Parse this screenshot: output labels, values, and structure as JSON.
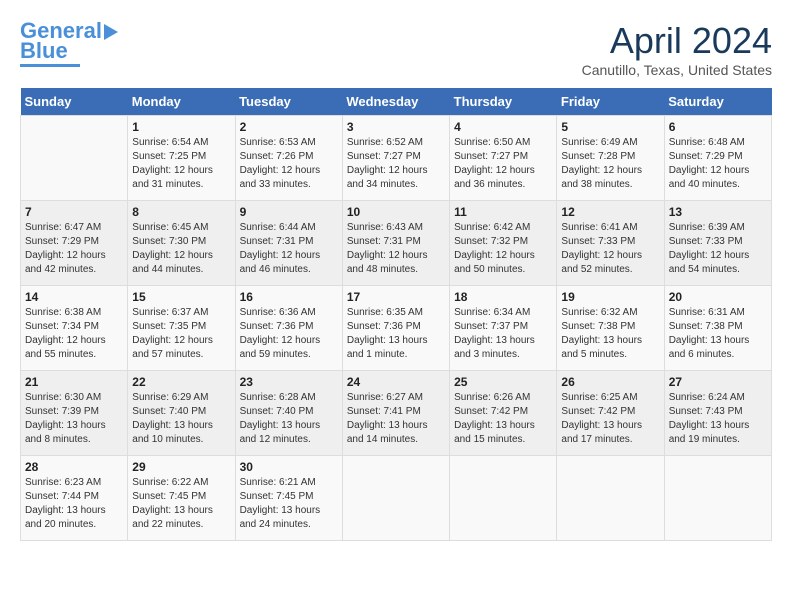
{
  "header": {
    "logo_line1": "General",
    "logo_line2": "Blue",
    "month_title": "April 2024",
    "location": "Canutillo, Texas, United States"
  },
  "calendar": {
    "days_of_week": [
      "Sunday",
      "Monday",
      "Tuesday",
      "Wednesday",
      "Thursday",
      "Friday",
      "Saturday"
    ],
    "weeks": [
      [
        {
          "day": "",
          "info": ""
        },
        {
          "day": "1",
          "info": "Sunrise: 6:54 AM\nSunset: 7:25 PM\nDaylight: 12 hours\nand 31 minutes."
        },
        {
          "day": "2",
          "info": "Sunrise: 6:53 AM\nSunset: 7:26 PM\nDaylight: 12 hours\nand 33 minutes."
        },
        {
          "day": "3",
          "info": "Sunrise: 6:52 AM\nSunset: 7:27 PM\nDaylight: 12 hours\nand 34 minutes."
        },
        {
          "day": "4",
          "info": "Sunrise: 6:50 AM\nSunset: 7:27 PM\nDaylight: 12 hours\nand 36 minutes."
        },
        {
          "day": "5",
          "info": "Sunrise: 6:49 AM\nSunset: 7:28 PM\nDaylight: 12 hours\nand 38 minutes."
        },
        {
          "day": "6",
          "info": "Sunrise: 6:48 AM\nSunset: 7:29 PM\nDaylight: 12 hours\nand 40 minutes."
        }
      ],
      [
        {
          "day": "7",
          "info": "Sunrise: 6:47 AM\nSunset: 7:29 PM\nDaylight: 12 hours\nand 42 minutes."
        },
        {
          "day": "8",
          "info": "Sunrise: 6:45 AM\nSunset: 7:30 PM\nDaylight: 12 hours\nand 44 minutes."
        },
        {
          "day": "9",
          "info": "Sunrise: 6:44 AM\nSunset: 7:31 PM\nDaylight: 12 hours\nand 46 minutes."
        },
        {
          "day": "10",
          "info": "Sunrise: 6:43 AM\nSunset: 7:31 PM\nDaylight: 12 hours\nand 48 minutes."
        },
        {
          "day": "11",
          "info": "Sunrise: 6:42 AM\nSunset: 7:32 PM\nDaylight: 12 hours\nand 50 minutes."
        },
        {
          "day": "12",
          "info": "Sunrise: 6:41 AM\nSunset: 7:33 PM\nDaylight: 12 hours\nand 52 minutes."
        },
        {
          "day": "13",
          "info": "Sunrise: 6:39 AM\nSunset: 7:33 PM\nDaylight: 12 hours\nand 54 minutes."
        }
      ],
      [
        {
          "day": "14",
          "info": "Sunrise: 6:38 AM\nSunset: 7:34 PM\nDaylight: 12 hours\nand 55 minutes."
        },
        {
          "day": "15",
          "info": "Sunrise: 6:37 AM\nSunset: 7:35 PM\nDaylight: 12 hours\nand 57 minutes."
        },
        {
          "day": "16",
          "info": "Sunrise: 6:36 AM\nSunset: 7:36 PM\nDaylight: 12 hours\nand 59 minutes."
        },
        {
          "day": "17",
          "info": "Sunrise: 6:35 AM\nSunset: 7:36 PM\nDaylight: 13 hours\nand 1 minute."
        },
        {
          "day": "18",
          "info": "Sunrise: 6:34 AM\nSunset: 7:37 PM\nDaylight: 13 hours\nand 3 minutes."
        },
        {
          "day": "19",
          "info": "Sunrise: 6:32 AM\nSunset: 7:38 PM\nDaylight: 13 hours\nand 5 minutes."
        },
        {
          "day": "20",
          "info": "Sunrise: 6:31 AM\nSunset: 7:38 PM\nDaylight: 13 hours\nand 6 minutes."
        }
      ],
      [
        {
          "day": "21",
          "info": "Sunrise: 6:30 AM\nSunset: 7:39 PM\nDaylight: 13 hours\nand 8 minutes."
        },
        {
          "day": "22",
          "info": "Sunrise: 6:29 AM\nSunset: 7:40 PM\nDaylight: 13 hours\nand 10 minutes."
        },
        {
          "day": "23",
          "info": "Sunrise: 6:28 AM\nSunset: 7:40 PM\nDaylight: 13 hours\nand 12 minutes."
        },
        {
          "day": "24",
          "info": "Sunrise: 6:27 AM\nSunset: 7:41 PM\nDaylight: 13 hours\nand 14 minutes."
        },
        {
          "day": "25",
          "info": "Sunrise: 6:26 AM\nSunset: 7:42 PM\nDaylight: 13 hours\nand 15 minutes."
        },
        {
          "day": "26",
          "info": "Sunrise: 6:25 AM\nSunset: 7:42 PM\nDaylight: 13 hours\nand 17 minutes."
        },
        {
          "day": "27",
          "info": "Sunrise: 6:24 AM\nSunset: 7:43 PM\nDaylight: 13 hours\nand 19 minutes."
        }
      ],
      [
        {
          "day": "28",
          "info": "Sunrise: 6:23 AM\nSunset: 7:44 PM\nDaylight: 13 hours\nand 20 minutes."
        },
        {
          "day": "29",
          "info": "Sunrise: 6:22 AM\nSunset: 7:45 PM\nDaylight: 13 hours\nand 22 minutes."
        },
        {
          "day": "30",
          "info": "Sunrise: 6:21 AM\nSunset: 7:45 PM\nDaylight: 13 hours\nand 24 minutes."
        },
        {
          "day": "",
          "info": ""
        },
        {
          "day": "",
          "info": ""
        },
        {
          "day": "",
          "info": ""
        },
        {
          "day": "",
          "info": ""
        }
      ]
    ]
  }
}
